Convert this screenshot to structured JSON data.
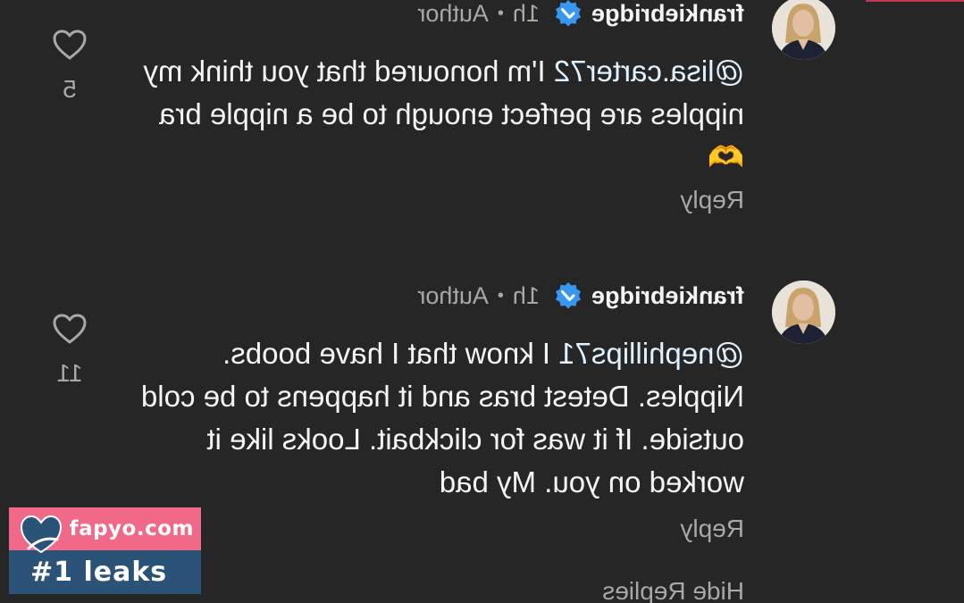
{
  "comments": [
    {
      "username": "frankiebridge",
      "time": "1h",
      "author_label": "Author",
      "mention": "@lisa.carter72",
      "text": " I'm honoured that you think my nipples are perfect enough to be a nipple bra 🫶",
      "reply_label": "Reply",
      "like_count": "5"
    },
    {
      "username": "frankiebridge",
      "time": "1h",
      "author_label": "Author",
      "mention": "@nephillips71",
      "text": " I know that I have boobs. Nipples. Detest bras and it happens to be cold outside. If it was for clickbait. Looks like it worked on you. My bad",
      "reply_label": "Reply",
      "like_count": "11"
    }
  ],
  "hide_replies": "Hide Replies",
  "watermark": {
    "site": "fapyo.com",
    "tagline": "#1 leaks"
  },
  "colors": {
    "background": "#262626",
    "verified": "#3897f0",
    "watermark_pink": "#f06988",
    "watermark_blue": "#2b5277"
  },
  "icons": [
    "heart-outline-icon",
    "verified-badge-icon",
    "heart-logo-icon"
  ]
}
